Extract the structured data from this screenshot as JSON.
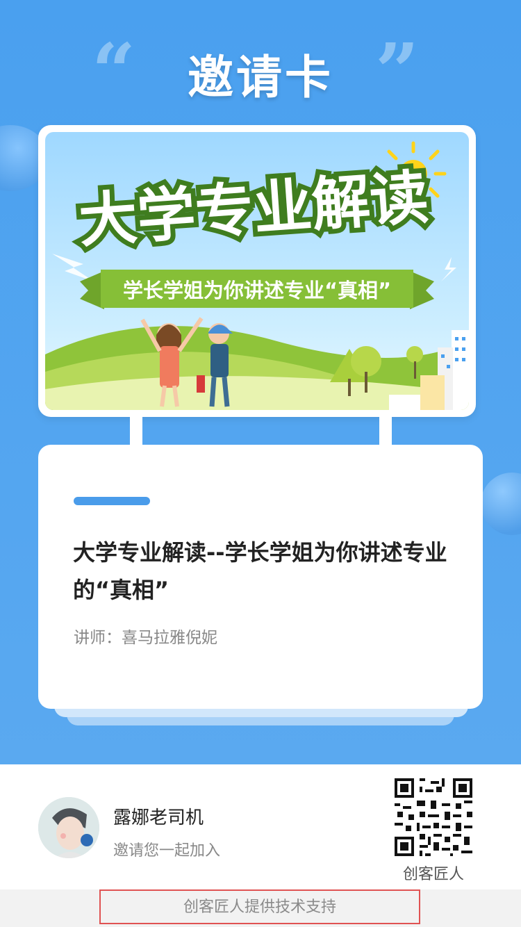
{
  "header": {
    "title": "邀请卡"
  },
  "banner": {
    "headline": "大学专业解读",
    "ribbon": "学长学姐为你讲述专业“真相”"
  },
  "course": {
    "title": "大学专业解读--学长学姐为你讲述专业的“真相”",
    "lecturer": "讲师：喜马拉雅倪妮"
  },
  "inviter": {
    "name": "露娜老司机",
    "message": "邀请您一起加入"
  },
  "qr": {
    "label": "创客匠人"
  },
  "footer": {
    "support_text": "创客匠人提供技术支持"
  },
  "colors": {
    "primary": "#4aa0ef",
    "accent_bar": "#4a9cea",
    "footer_border": "#e05252"
  }
}
